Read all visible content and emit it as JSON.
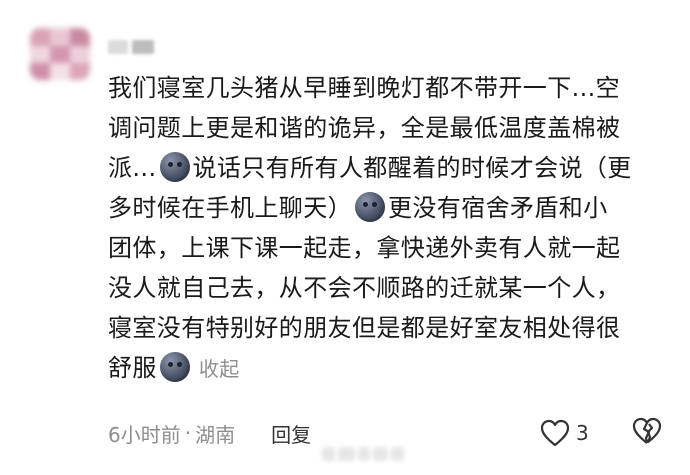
{
  "comment": {
    "lines": [
      "我们寝室几头猪从早睡到晚灯都不带开一下...空",
      "调问题上更是和谐的诡异，全是最低温度盖棉被",
      "派...",
      "说话只有所有人都醒着的时候才会说（更",
      "多时候在手机上聊天）",
      "更没有宿舍矛盾和小",
      "团体，上课下课一起走，拿快递外卖有人就一起",
      "没人就自己去，从不会不顺路的迁就某一个人，",
      "寝室没有特别好的朋友但是都是好室友相处得很",
      "舒服"
    ],
    "collapse_label": "收起",
    "emoji_name": "moon-face-emoji"
  },
  "meta": {
    "time": "6小时前",
    "separator": "·",
    "location": "湖南",
    "reply_label": "回复"
  },
  "actions": {
    "like_count": "3",
    "like_icon": "heart-outline-icon",
    "dislike_icon": "broken-heart-icon"
  },
  "colors": {
    "text": "#1a1a1a",
    "muted": "#8e8e8e",
    "emoji": "#4c5569"
  }
}
